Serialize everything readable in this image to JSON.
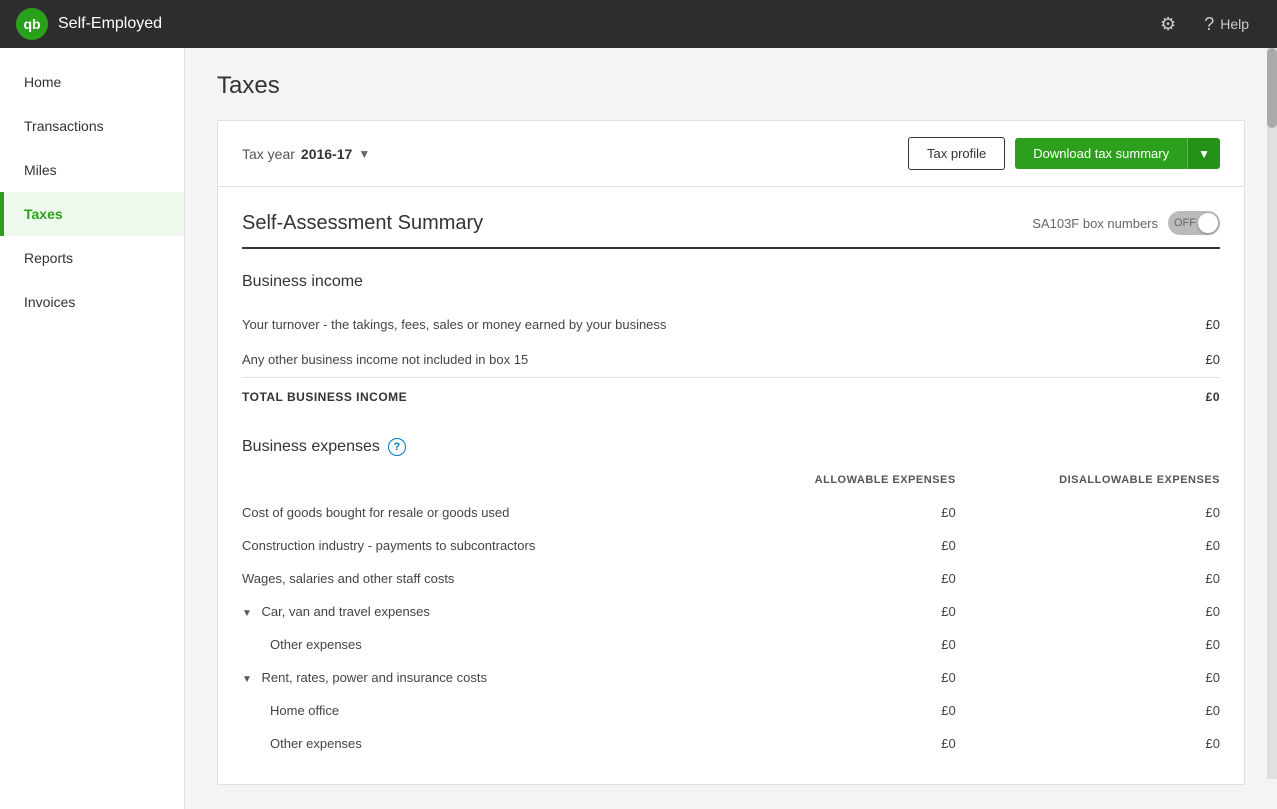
{
  "topnav": {
    "logo_text": "qb",
    "app_title": "Self-Employed",
    "gear_label": "",
    "help_label": "Help"
  },
  "sidebar": {
    "items": [
      {
        "id": "home",
        "label": "Home",
        "active": false
      },
      {
        "id": "transactions",
        "label": "Transactions",
        "active": false
      },
      {
        "id": "miles",
        "label": "Miles",
        "active": false
      },
      {
        "id": "taxes",
        "label": "Taxes",
        "active": true
      },
      {
        "id": "reports",
        "label": "Reports",
        "active": false
      },
      {
        "id": "invoices",
        "label": "Invoices",
        "active": false
      }
    ]
  },
  "page": {
    "title": "Taxes"
  },
  "tax_year_bar": {
    "label": "Tax year",
    "value": "2016-17",
    "tax_profile_btn": "Tax profile",
    "download_btn": "Download tax summary"
  },
  "summary": {
    "title": "Self-Assessment Summary",
    "sa103f_label": "SA103F box numbers",
    "toggle_label": "OFF"
  },
  "business_income": {
    "section_title": "Business income",
    "rows": [
      {
        "description": "Your turnover - the takings, fees, sales or money earned by your business",
        "value": "£0"
      },
      {
        "description": "Any other business income not included in box 15",
        "value": "£0"
      }
    ],
    "total_label": "TOTAL BUSINESS INCOME",
    "total_value": "£0"
  },
  "business_expenses": {
    "section_title": "Business expenses",
    "col_allowable": "ALLOWABLE EXPENSES",
    "col_disallowable": "DISALLOWABLE EXPENSES",
    "rows": [
      {
        "type": "normal",
        "description": "Cost of goods bought for resale or goods used",
        "allowable": "£0",
        "disallowable": "£0"
      },
      {
        "type": "normal",
        "description": "Construction industry - payments to subcontractors",
        "allowable": "£0",
        "disallowable": "£0"
      },
      {
        "type": "normal",
        "description": "Wages, salaries and other staff costs",
        "allowable": "£0",
        "disallowable": "£0"
      },
      {
        "type": "expand",
        "description": "Car, van and travel expenses",
        "allowable": "£0",
        "disallowable": "£0"
      },
      {
        "type": "sub",
        "description": "Other expenses",
        "allowable": "£0",
        "disallowable": "£0"
      },
      {
        "type": "expand",
        "description": "Rent, rates, power and insurance costs",
        "allowable": "£0",
        "disallowable": "£0"
      },
      {
        "type": "sub",
        "description": "Home office",
        "allowable": "£0",
        "disallowable": "£0"
      },
      {
        "type": "sub",
        "description": "Other expenses",
        "allowable": "£0",
        "disallowable": "£0"
      }
    ]
  }
}
